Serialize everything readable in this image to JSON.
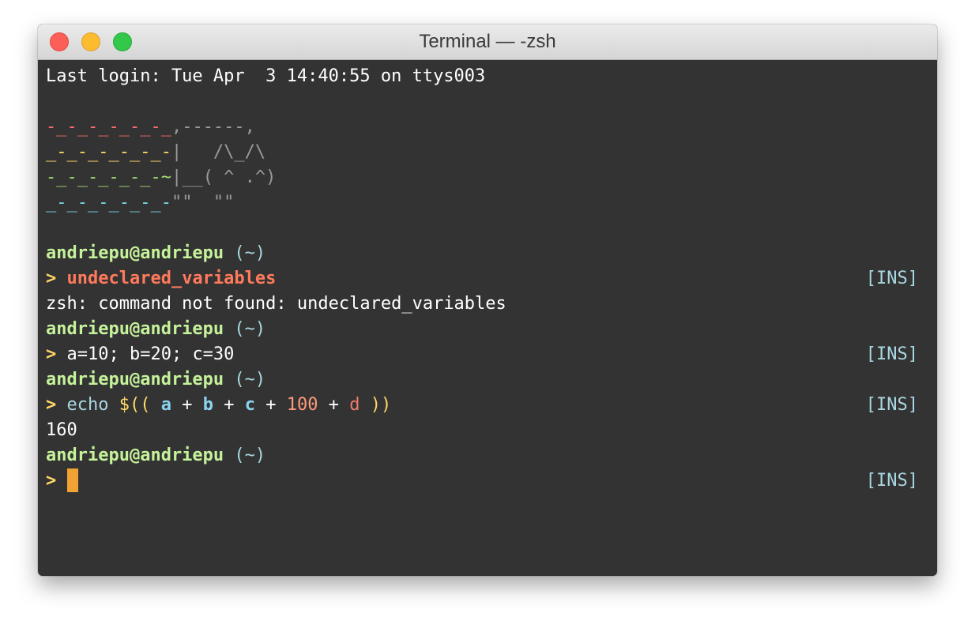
{
  "window": {
    "title": "Terminal — -zsh"
  },
  "colors": {
    "background": "#333333",
    "prompt_user": "#c5f29a",
    "prompt_dir": "#a9d7e1",
    "prompt_arrow": "#ffd866",
    "error_command": "#ff7a5c",
    "number": "#ff9a7a",
    "undefined_var": "#f07c6c",
    "variable": "#8ad4f0",
    "cursor": "#f0a232",
    "mode_indicator": "#a9d7e1"
  },
  "terminal": {
    "last_login": "Last login: Tue Apr  3 14:40:55 on ttys003",
    "art": {
      "row1_trail": "-_-_-_-_-_-_",
      "row1_body": ",------,",
      "row2_trail": "_-_-_-_-_-_-",
      "row2_body": "|   /\\_/\\",
      "row3_trail": "-_-_-_-_-_-~",
      "row3_body": "|__( ^ .^)",
      "row4_trail": "_-_-_-_-_-_-",
      "row4_body": "\"\"  \"\""
    },
    "prompt_user": "andriepu@andriepu",
    "prompt_dir": "(~)",
    "prompt_arrow": ">",
    "mode": "[INS]",
    "cmd1": "undeclared_variables",
    "error1": "zsh: command not found: undeclared_variables",
    "cmd2": "a=10; b=20; c=30",
    "cmd3": {
      "echo": "echo",
      "open": "$((",
      "a": "a",
      "plus": "+",
      "b": "b",
      "c": "c",
      "num": "100",
      "d": "d",
      "close": "))"
    },
    "output3": "160"
  }
}
